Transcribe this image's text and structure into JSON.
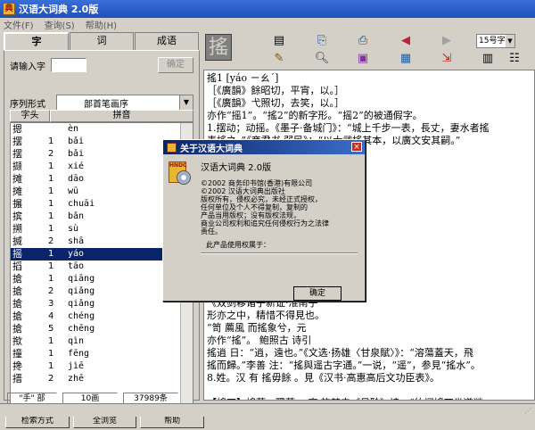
{
  "window": {
    "title": "汉语大词典 2.0版"
  },
  "menu": [
    "文件(F)",
    "查询(S)",
    "帮助(H)"
  ],
  "left": {
    "tabs": [
      "字",
      "词",
      "成语"
    ],
    "input_label": "请输入字",
    "input_value": "",
    "locate_btn": "确定",
    "sort_label": "序列形式",
    "sort_value": "部首笔画序",
    "col_char": "字头",
    "col_pinyin": "拼音",
    "rows": [
      {
        "c": "摁",
        "n": "",
        "p": "èn"
      },
      {
        "c": "摆",
        "n": "1",
        "p": "bǎi"
      },
      {
        "c": "摆",
        "n": "2",
        "p": "bǎi"
      },
      {
        "c": "撷",
        "n": "1",
        "p": "xié"
      },
      {
        "c": "摊",
        "n": "1",
        "p": "dāo"
      },
      {
        "c": "摊",
        "n": "1",
        "p": "wū"
      },
      {
        "c": "搌",
        "n": "1",
        "p": "chuāi"
      },
      {
        "c": "摈",
        "n": "1",
        "p": "bǎn"
      },
      {
        "c": "搠",
        "n": "1",
        "p": "sù"
      },
      {
        "c": "搣",
        "n": "2",
        "p": "shā"
      },
      {
        "c": "摇",
        "n": "1",
        "p": "yáo"
      },
      {
        "c": "搯",
        "n": "1",
        "p": "tāo"
      },
      {
        "c": "搶",
        "n": "1",
        "p": "qiāng"
      },
      {
        "c": "搶",
        "n": "2",
        "p": "qiǎng"
      },
      {
        "c": "搶",
        "n": "3",
        "p": "qiǎng"
      },
      {
        "c": "搶",
        "n": "4",
        "p": "chéng"
      },
      {
        "c": "搶",
        "n": "5",
        "p": "chēng"
      },
      {
        "c": "揿",
        "n": "1",
        "p": "qìn"
      },
      {
        "c": "撞",
        "n": "1",
        "p": "fēng"
      },
      {
        "c": "搀",
        "n": "1",
        "p": "jìē"
      },
      {
        "c": "搢",
        "n": "2",
        "p": "zhē"
      }
    ],
    "selected_index": 10,
    "stat1": "\"手\" 部",
    "stat2": "10画",
    "stat3": "37989条",
    "btn_search": "检索方式",
    "btn_all": "全浏览",
    "btn_help": "帮助"
  },
  "toolbar": {
    "big_char": "搖",
    "font_select": "15号字"
  },
  "content": {
    "lines": [
      "搖1  [yáo  ㄧㄠˊ]",
      "［《廣韻》餘昭切，平宵，以。］",
      "［《廣韻》弋照切，去笑，以。］",
      "亦作“摇1”。“搖2”的新字形。“摇2”的被通假字。",
      "1.摆动；动摇。《墨子·备城门》：“城上千步一表，長丈，妻水者搖",
      "表搖之。”《商君书·弱民》：“以大武搖其本，以廣文安其嗣。”",
      "                                          ，而同元世，東風搖百草。",
      "                                          北周",
      "                                         ，諸民之心搖矣。”元 陈孚",
      "                                          ，掘裂插搖道 道路。”周而复",
      "                                         ，一下紧紅的钢带，使劲的搖了一",
      "                                          ，一顏巍起而搖埋兮，雾長元",
      "                                         ，搖起，疾起也。疾起",
      "                                          ，疾起也。”3.上升。汉 冠固",
      "                                          ，搖擊。”参见“搖擊”。4.骚扰。",
      "                                          ，暴、建封、環 及 李晏 四",
      "                                          ，元·世祖紀八》：“又定",
      "                                         5.挑，尚且。《淮南子·要",
      "                                         《双剑簃诸子新证·淮南子",
      "                                         形亦之中，精惜不得見也。",
      "                                          “笥 薦風 而搖象兮，元",
      "                                          亦作“搖”。 鲍照古 诗引",
      "搖逍 日：“逍，遠也。”《文选·扬雄〈甘泉賦〉》：“溶蕩蓋天，飛",
      "搖而歸。”李善 注：“搖與遥古字通。”一说，“遥”，参見“搖水”。",
      "8.姓。汉 有 搖毋餘 。見《汉书·高惠高后文功臣表》。",
      "",
      "【搖兀】搖蕩；飄蕩。 宋 許焚夫《星聆》诗：“竹间搖兀坐遂谜，",
      "石谓湛湖明见過。”陈三立《晚抵九江作》诗：“雞舟夜半青之去，",
      "搖兀江湖便可憐。”",
      "【搖丸】对幸丸。大幸如名一种。《西吃杂记》送西。” 富此 有 白生"
    ]
  },
  "dialog": {
    "title": "关于汉语大词典",
    "close": "×",
    "product": "汉语大词典  2.0版",
    "info": [
      "©2002   商务印书馆(香港)有限公司",
      "©2002   汉语大词典出版社",
      "版权所有，侵权必究，未经正式授权，",
      "任何单位及个人不得复制，复制的",
      "产品当用版权；没有版权法规，",
      "商业公司权利和追究任何侵权行为之法律",
      "责任。"
    ],
    "license_label": "此产品使用权属于：",
    "ok": "确定",
    "logo_text": "HNDC"
  }
}
